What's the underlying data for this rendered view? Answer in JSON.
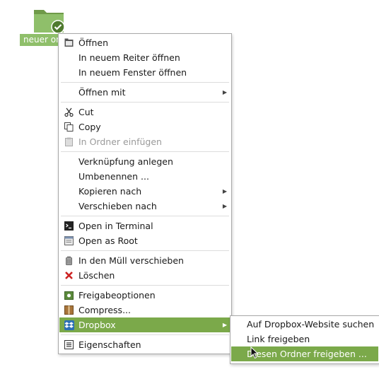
{
  "desktop": {
    "folder_label": "neuer ordner"
  },
  "context_menu": {
    "items": [
      {
        "label": "Öffnen"
      },
      {
        "label": "In neuem Reiter öffnen"
      },
      {
        "label": "In neuem Fenster öffnen"
      },
      {
        "label": "Öffnen mit"
      },
      {
        "label": "Cut"
      },
      {
        "label": "Copy"
      },
      {
        "label": "In Ordner einfügen"
      },
      {
        "label": "Verknüpfung anlegen"
      },
      {
        "label": "Umbenennen ..."
      },
      {
        "label": "Kopieren nach"
      },
      {
        "label": "Verschieben nach"
      },
      {
        "label": "Open in Terminal"
      },
      {
        "label": "Open as Root"
      },
      {
        "label": "In den Müll verschieben"
      },
      {
        "label": "Löschen"
      },
      {
        "label": "Freigabeoptionen"
      },
      {
        "label": "Compress..."
      },
      {
        "label": "Dropbox"
      },
      {
        "label": "Eigenschaften"
      }
    ]
  },
  "dropbox_submenu": {
    "items": [
      {
        "label": "Auf Dropbox-Website suchen"
      },
      {
        "label": "Link freigeben"
      },
      {
        "label": "Diesen Ordner freigeben ..."
      }
    ]
  },
  "colors": {
    "highlight": "#7ba94a",
    "disabled_text": "#9a9a9a",
    "folder_green": "#6f9a48"
  }
}
